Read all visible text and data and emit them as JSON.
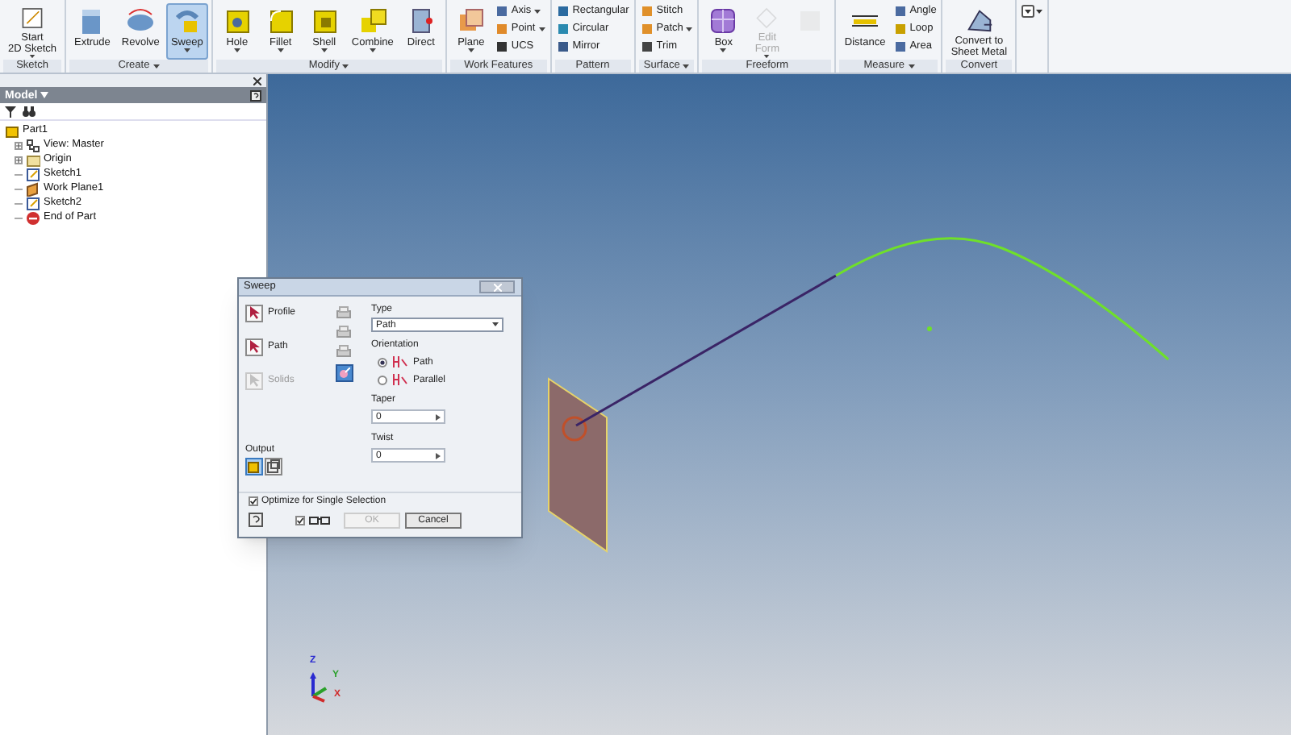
{
  "ribbon": {
    "groups": [
      {
        "label": "Sketch",
        "dropdown": false,
        "items": [
          {
            "kind": "large",
            "label": "Start\n2D Sketch",
            "selected": false,
            "disabled": false,
            "caret": true
          }
        ]
      },
      {
        "label": "Create",
        "dropdown": true,
        "items": [
          {
            "kind": "large",
            "label": "Extrude",
            "selected": false,
            "disabled": false,
            "caret": false
          },
          {
            "kind": "large",
            "label": "Revolve",
            "selected": false,
            "disabled": false,
            "caret": false
          },
          {
            "kind": "large",
            "label": "Sweep",
            "selected": true,
            "disabled": false,
            "caret": true
          }
        ]
      },
      {
        "label": "Modify",
        "dropdown": true,
        "items": [
          {
            "kind": "large",
            "label": "Hole",
            "selected": false,
            "disabled": false,
            "caret": true
          },
          {
            "kind": "large",
            "label": "Fillet",
            "selected": false,
            "disabled": false,
            "caret": true
          },
          {
            "kind": "large",
            "label": "Shell",
            "selected": false,
            "disabled": false,
            "caret": true
          },
          {
            "kind": "large",
            "label": "Combine",
            "selected": false,
            "disabled": false,
            "caret": true
          },
          {
            "kind": "large",
            "label": "Direct",
            "selected": false,
            "disabled": false,
            "caret": false
          }
        ]
      },
      {
        "label": "Work Features",
        "dropdown": false,
        "items": [
          {
            "kind": "large",
            "label": "Plane",
            "selected": false,
            "disabled": false,
            "caret": true
          },
          {
            "kind": "small",
            "label": "Axis",
            "selected": false,
            "disabled": false,
            "caret": true
          },
          {
            "kind": "small",
            "label": "Point",
            "selected": false,
            "disabled": false,
            "caret": true
          },
          {
            "kind": "small",
            "label": "UCS",
            "selected": false,
            "disabled": false,
            "caret": false
          }
        ]
      },
      {
        "label": "Pattern",
        "dropdown": false,
        "items": [
          {
            "kind": "small",
            "label": "Rectangular",
            "selected": false,
            "disabled": false,
            "caret": false
          },
          {
            "kind": "small",
            "label": "Circular",
            "selected": false,
            "disabled": false,
            "caret": false
          },
          {
            "kind": "small",
            "label": "Mirror",
            "selected": false,
            "disabled": false,
            "caret": false
          }
        ]
      },
      {
        "label": "Surface",
        "dropdown": true,
        "items": [
          {
            "kind": "small",
            "label": "Stitch",
            "selected": false,
            "disabled": false,
            "caret": false
          },
          {
            "kind": "small",
            "label": "Patch",
            "selected": false,
            "disabled": false,
            "caret": true
          },
          {
            "kind": "small",
            "label": "Trim",
            "selected": false,
            "disabled": false,
            "caret": false
          }
        ]
      },
      {
        "label": "Freeform",
        "dropdown": false,
        "items": [
          {
            "kind": "large",
            "label": "Box",
            "selected": false,
            "disabled": false,
            "caret": true
          },
          {
            "kind": "large",
            "label": "Edit\nForm",
            "selected": false,
            "disabled": true,
            "caret": true
          },
          {
            "kind": "icon",
            "selected": false,
            "disabled": true,
            "caret": false
          }
        ]
      },
      {
        "label": "Measure",
        "dropdown": true,
        "items": [
          {
            "kind": "large",
            "label": "Distance",
            "selected": false,
            "disabled": false,
            "caret": false
          },
          {
            "kind": "small",
            "label": "Angle",
            "selected": false,
            "disabled": false,
            "caret": false
          },
          {
            "kind": "small",
            "label": "Loop",
            "selected": false,
            "disabled": false,
            "caret": false
          },
          {
            "kind": "small",
            "label": "Area",
            "selected": false,
            "disabled": false,
            "caret": false
          }
        ]
      },
      {
        "label": "Convert",
        "dropdown": false,
        "items": [
          {
            "kind": "large",
            "label": "Convert to\nSheet Metal",
            "selected": false,
            "disabled": false,
            "caret": false
          }
        ]
      }
    ]
  },
  "browser": {
    "title": "Model",
    "tree": [
      {
        "label": "Part1",
        "kind": "part",
        "children": [
          {
            "label": "View: Master",
            "kind": "view",
            "expanded": false
          },
          {
            "label": "Origin",
            "kind": "folder",
            "expanded": false
          },
          {
            "label": "Sketch1",
            "kind": "sketch"
          },
          {
            "label": "Work Plane1",
            "kind": "plane"
          },
          {
            "label": "Sketch2",
            "kind": "sketch"
          },
          {
            "label": "End of Part",
            "kind": "end"
          }
        ]
      }
    ]
  },
  "dialog": {
    "title": "Sweep",
    "selectors": [
      {
        "label": "Profile",
        "disabled": false
      },
      {
        "label": "Path",
        "disabled": false
      },
      {
        "label": "Solids",
        "disabled": true
      }
    ],
    "type_label": "Type",
    "type_value": "Path",
    "orientation_label": "Orientation",
    "orientation": [
      {
        "label": "Path",
        "selected": true
      },
      {
        "label": "Parallel",
        "selected": false
      }
    ],
    "taper_label": "Taper",
    "taper": "0",
    "twist_label": "Twist",
    "twist": "0",
    "output_label": "Output",
    "outputs": [
      {
        "kind": "solid",
        "selected": true
      },
      {
        "kind": "surface",
        "selected": false
      }
    ],
    "optimize": {
      "label": "Optimize for Single Selection",
      "checked": true
    },
    "preview_checked": true,
    "buttons": [
      {
        "label": "OK",
        "disabled": true
      },
      {
        "label": "Cancel",
        "disabled": false
      }
    ]
  },
  "viewport": {
    "triad": [
      {
        "label": "Z"
      },
      {
        "label": "Y"
      },
      {
        "label": "X"
      }
    ]
  }
}
